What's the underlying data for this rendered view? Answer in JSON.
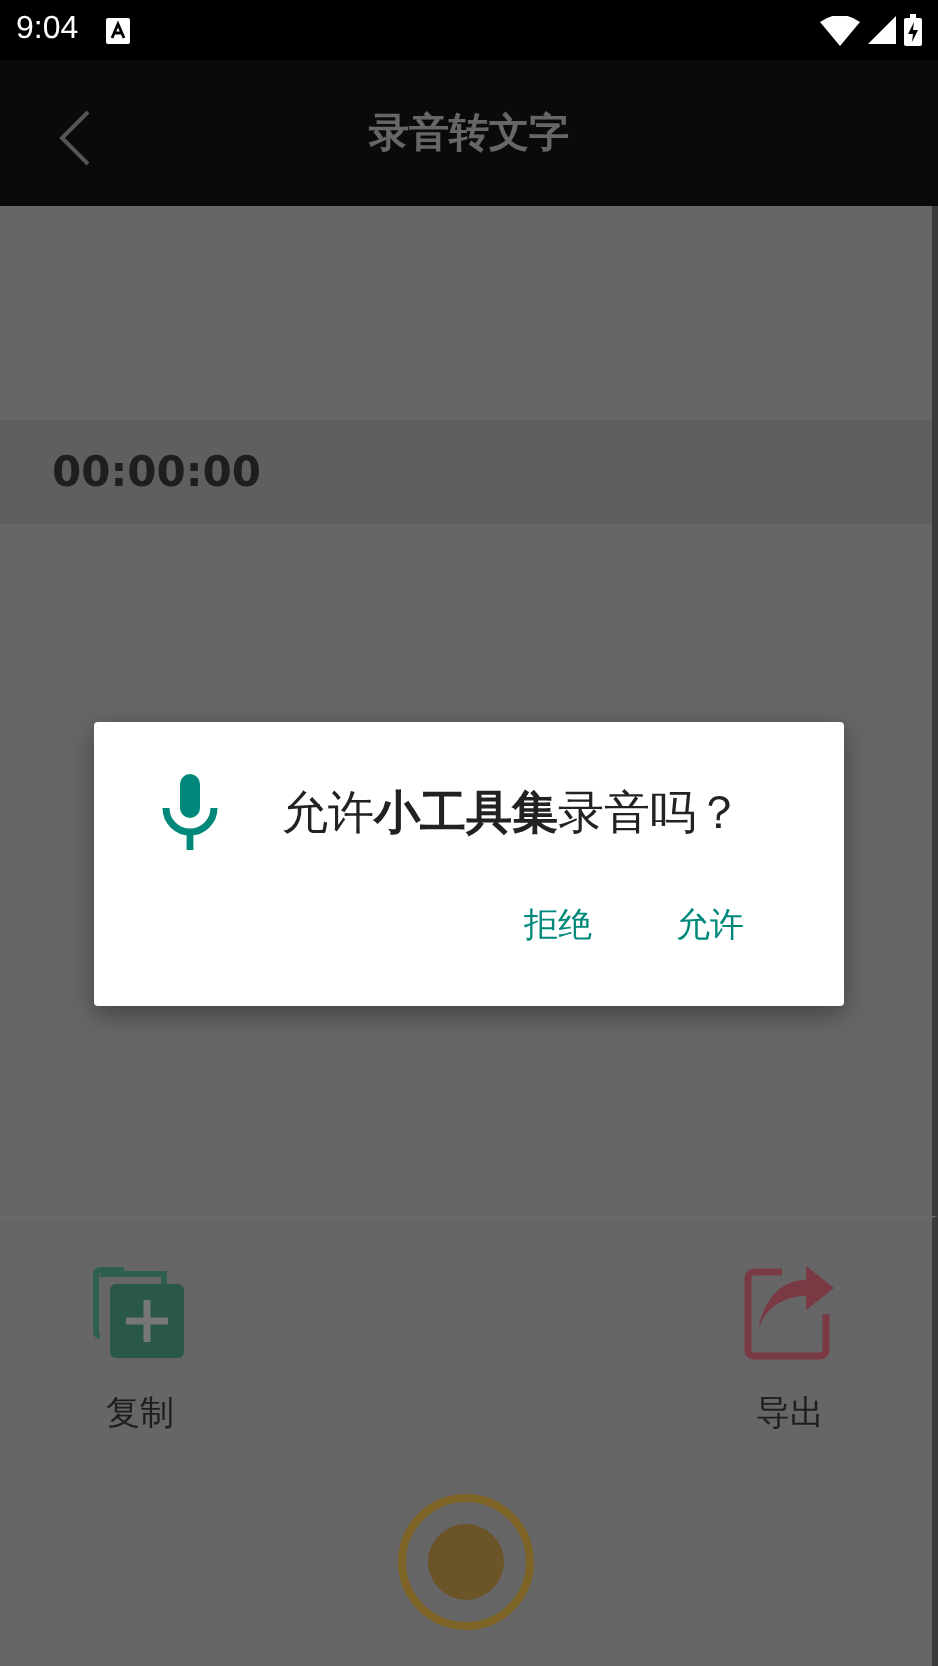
{
  "status_bar": {
    "time": "9:04"
  },
  "app_bar": {
    "title": "录音转文字"
  },
  "timer": "00:00:00",
  "actions": [
    {
      "label": "复制",
      "kind": "copy"
    },
    {
      "label": "导出",
      "kind": "export"
    }
  ],
  "dialog": {
    "message": "允许**小工具集**录音吗？",
    "buttons": [
      {
        "label": "拒绝"
      },
      {
        "label": "允许"
      }
    ]
  }
}
